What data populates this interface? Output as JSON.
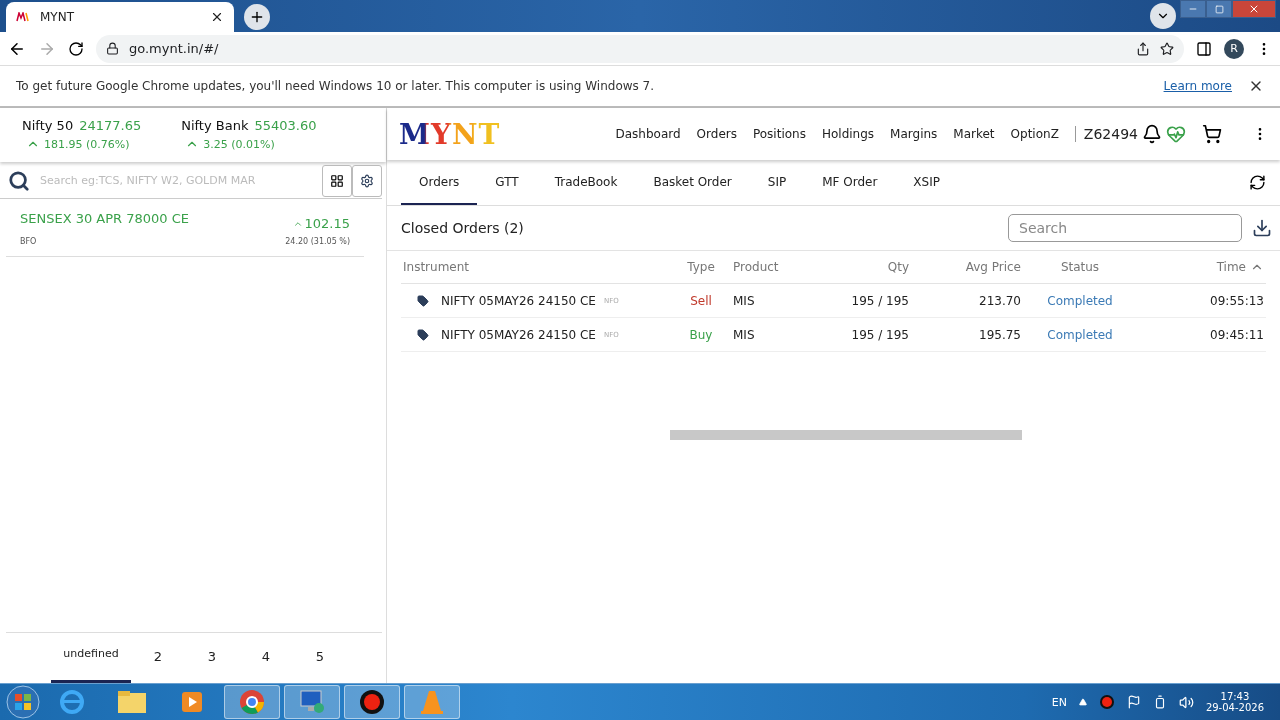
{
  "browser": {
    "tab_title": "MYNT",
    "address": "go.mynt.in/#/",
    "profile_initial": "R"
  },
  "infobar": {
    "message": "To get future Google Chrome updates, you'll need Windows 10 or later. This computer is using Windows 7.",
    "link": "Learn more"
  },
  "indices": [
    {
      "name": "Nifty 50",
      "value": "24177.65",
      "change": "181.95 (0.76%)"
    },
    {
      "name": "Nifty Bank",
      "value": "55403.60",
      "change": "3.25 (0.01%)"
    }
  ],
  "watch_search": {
    "placeholder": "Search eg:TCS, NIFTY W2, GOLDM MAR"
  },
  "watchlist": [
    {
      "symbol": "SENSEX 30 APR 78000 CE",
      "exchange": "BFO",
      "ltp": "102.15",
      "change": "24.20 (31.05 %)"
    }
  ],
  "watch_pages": [
    {
      "label": "undefined",
      "selected": true
    },
    {
      "label": "2",
      "selected": false
    },
    {
      "label": "3",
      "selected": false
    },
    {
      "label": "4",
      "selected": false
    },
    {
      "label": "5",
      "selected": false
    }
  ],
  "logo": "MYNT",
  "nav": [
    "Dashboard",
    "Orders",
    "Positions",
    "Holdings",
    "Margins",
    "Market",
    "OptionZ"
  ],
  "client_id": "Z62494",
  "sub_tabs": [
    {
      "label": "Orders",
      "selected": true
    },
    {
      "label": "GTT",
      "selected": false
    },
    {
      "label": "TradeBook",
      "selected": false
    },
    {
      "label": "Basket Order",
      "selected": false
    },
    {
      "label": "SIP",
      "selected": false
    },
    {
      "label": "MF Order",
      "selected": false
    },
    {
      "label": "XSIP",
      "selected": false
    }
  ],
  "orders": {
    "title": "Closed Orders (2)",
    "search_placeholder": "Search",
    "columns": [
      {
        "label": "Instrument",
        "sorted": false
      },
      {
        "label": "Type",
        "sorted": false
      },
      {
        "label": "Product",
        "sorted": false
      },
      {
        "label": "Qty",
        "sorted": false
      },
      {
        "label": "Avg Price",
        "sorted": false
      },
      {
        "label": "Status",
        "sorted": false
      },
      {
        "label": "Time",
        "sorted": true
      }
    ],
    "rows": [
      {
        "instrument": "NIFTY 05MAY26 24150 CE",
        "exchange": "NFO",
        "type": "Sell",
        "kind": "sell",
        "product": "MIS",
        "qty": "195 / 195",
        "avg_price": "213.70",
        "status": "Completed",
        "time": "09:55:13"
      },
      {
        "instrument": "NIFTY 05MAY26 24150 CE",
        "exchange": "NFO",
        "type": "Buy",
        "kind": "buy",
        "product": "MIS",
        "qty": "195 / 195",
        "avg_price": "195.75",
        "status": "Completed",
        "time": "09:45:11"
      }
    ]
  },
  "taskbar": {
    "language": "EN",
    "time": "17:43",
    "date": "29-04-2026"
  }
}
